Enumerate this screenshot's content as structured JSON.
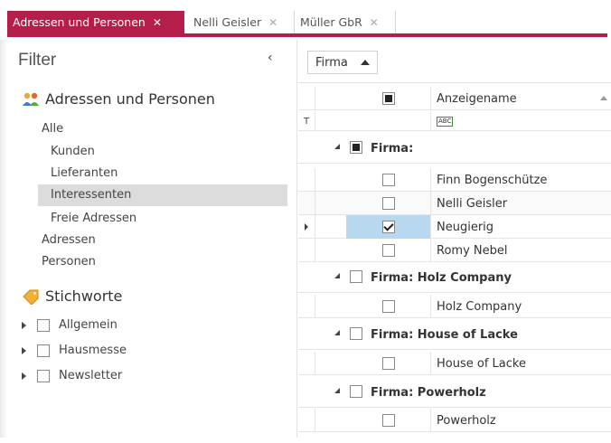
{
  "tabs": [
    {
      "label": "Adressen und Personen",
      "close": "✕",
      "active": true
    },
    {
      "label": "Nelli Geisler",
      "close": "✕",
      "active": false
    },
    {
      "label": "Müller GbR",
      "close": "✕",
      "active": false
    }
  ],
  "filter": {
    "title": "Filter",
    "collapse_icon": "‹",
    "section_addresses": "Adressen und Personen",
    "items": [
      {
        "label": "Alle"
      },
      {
        "label": "Kunden"
      },
      {
        "label": "Lieferanten"
      },
      {
        "label": "Interessenten",
        "selected": true
      },
      {
        "label": "Freie Adressen"
      },
      {
        "label": "Adressen"
      },
      {
        "label": "Personen"
      }
    ],
    "section_keywords": "Stichworte",
    "keywords": [
      {
        "label": "Allgemein"
      },
      {
        "label": "Hausmesse"
      },
      {
        "label": "Newsletter"
      }
    ]
  },
  "grid": {
    "group_chip": "Firma",
    "column_name": "Anzeigename",
    "filter_row_icon": "T",
    "abc_icon": "ABC",
    "groups": [
      {
        "label": "Firma:",
        "rows": [
          "Finn Bogenschütze",
          "Nelli Geisler",
          "Neugierig",
          "Romy Nebel"
        ]
      },
      {
        "label": "Firma: Holz Company",
        "rows": [
          "Holz Company"
        ]
      },
      {
        "label": "Firma: House of Lacke",
        "rows": [
          "House of Lacke"
        ]
      },
      {
        "label": "Firma: Powerholz",
        "rows": [
          "Powerholz"
        ]
      }
    ]
  },
  "colors": {
    "accent": "#b51e4a",
    "selection": "#b8d8f0"
  }
}
